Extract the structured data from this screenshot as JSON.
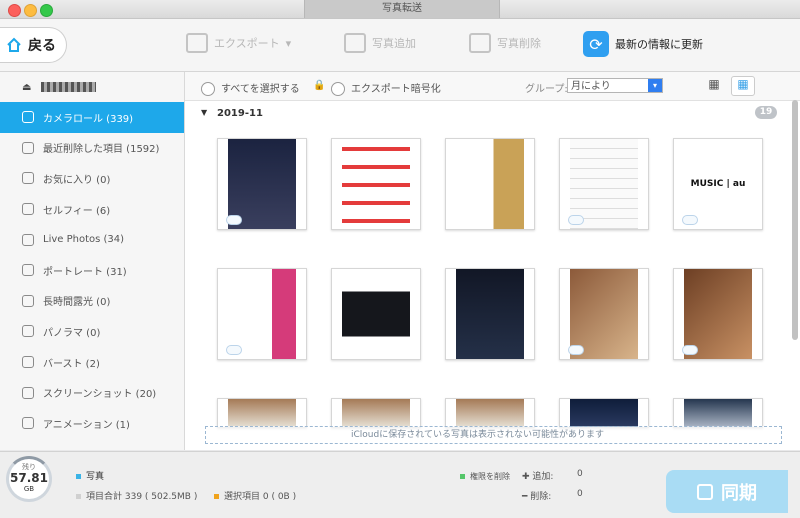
{
  "window": {
    "title": "写真転送"
  },
  "toolbar": {
    "back_label": "戻る",
    "export_label": "エクスポート",
    "add_label": "写真追加",
    "delete_label": "写真削除",
    "refresh_label": "最新の情報に更新"
  },
  "sidebar": {
    "device_name": "",
    "items": [
      {
        "label": "カメラロール (339)",
        "icon": "camera-icon",
        "active": true
      },
      {
        "label": "最近削除した項目 (1592)",
        "icon": "trash-icon"
      },
      {
        "label": "お気に入り (0)",
        "icon": "heart-icon"
      },
      {
        "label": "セルフィー (6)",
        "icon": "person-icon"
      },
      {
        "label": "Live Photos (34)",
        "icon": "live-icon"
      },
      {
        "label": "ポートレート (31)",
        "icon": "cube-icon"
      },
      {
        "label": "長時間露光 (0)",
        "icon": "exposure-icon"
      },
      {
        "label": "パノラマ (0)",
        "icon": "panorama-icon"
      },
      {
        "label": "バースト (2)",
        "icon": "burst-icon"
      },
      {
        "label": "スクリーンショット (20)",
        "icon": "screenshot-icon"
      },
      {
        "label": "アニメーション (1)",
        "icon": "animation-icon"
      }
    ]
  },
  "filter": {
    "select_all": "すべてを選択する",
    "export_encrypt": "エクスポート暗号化",
    "group_label": "グループ:",
    "group_value": "月により"
  },
  "group": {
    "date": "2019-11",
    "count": "19"
  },
  "notice": {
    "text": "iCloudに保存されている写真は表示されない可能性があります"
  },
  "thumbs": [
    {
      "kind": "game"
    },
    {
      "kind": "list-red"
    },
    {
      "kind": "chart"
    },
    {
      "kind": "table-jp"
    },
    {
      "kind": "music-au",
      "text": " MUSIC | au"
    },
    {
      "kind": "music-banner"
    },
    {
      "kind": "dark-strip"
    },
    {
      "kind": "phone-grid"
    },
    {
      "kind": "photo-brown"
    },
    {
      "kind": "photo-brown2"
    },
    {
      "kind": "photo-room"
    },
    {
      "kind": "photo-room"
    },
    {
      "kind": "photo-room"
    },
    {
      "kind": "photo-dark"
    },
    {
      "kind": "photo-dark2"
    }
  ],
  "bottom": {
    "storage_label": "残り",
    "storage_value": "57.81",
    "storage_unit": "GB",
    "photos_label": "写真",
    "total": "項目合計 339 ( 502.5MB )",
    "selected": "選択項目 0 ( 0B )",
    "perm_delete": "権限を削除",
    "add_label": "追加:",
    "add_value": "0",
    "remove_label": "削除:",
    "remove_value": "0",
    "sync_label": "同期"
  },
  "colors": {
    "accent": "#1ea8ea",
    "sync": "#a9dcf4",
    "selected_dot": "#f0a31c",
    "total_dot": "#d0d0d0"
  }
}
